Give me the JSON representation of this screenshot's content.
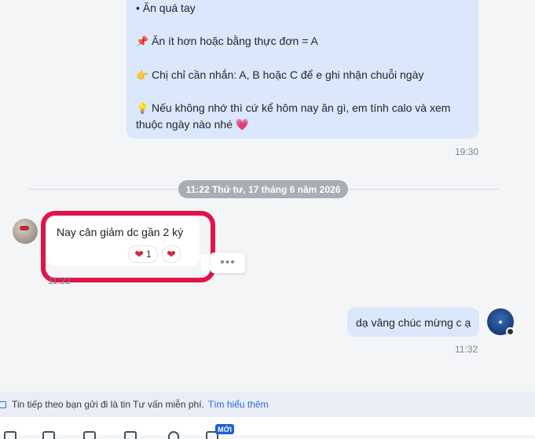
{
  "top_message": {
    "lines": [
      {
        "emoji": "",
        "text": "• Ăn quá tay"
      },
      {
        "emoji": "📌",
        "text": "Ăn ít hơn hoặc bằng thực đơn = A"
      },
      {
        "emoji": "👉",
        "text": "Chị chỉ cần nhắn: A, B hoặc C để e ghi nhận chuỗi ngày"
      },
      {
        "emoji": "💡",
        "text": "Nếu không nhớ thì cứ kể hôm nay ăn gì, em tính calo và xem"
      },
      {
        "emoji": "",
        "text": "thuộc ngày nào nhé 💗"
      }
    ],
    "time": "19:30"
  },
  "date_separator": "11:22 Thứ tư, 17 tháng 6 năm 2026",
  "incoming_message": {
    "text": "Nay cân giảm dc gần 2 ký",
    "reaction_count": "1",
    "reaction_icon": "❤",
    "time": "11:22",
    "more_label": "•••"
  },
  "outgoing_message": {
    "text": "dạ vâng chúc mừng c ạ",
    "time": "11:32"
  },
  "notice": {
    "text": "Tin tiếp theo bạn gửi đi là tin Tư vấn miễn phí.",
    "link": "Tìm hiểu thêm"
  },
  "toolbar": {
    "new_badge": "MỚI"
  },
  "colors": {
    "outgoing_bubble": "#dbe7fb",
    "highlight": "#e0134b",
    "link": "#2a6bd6"
  }
}
